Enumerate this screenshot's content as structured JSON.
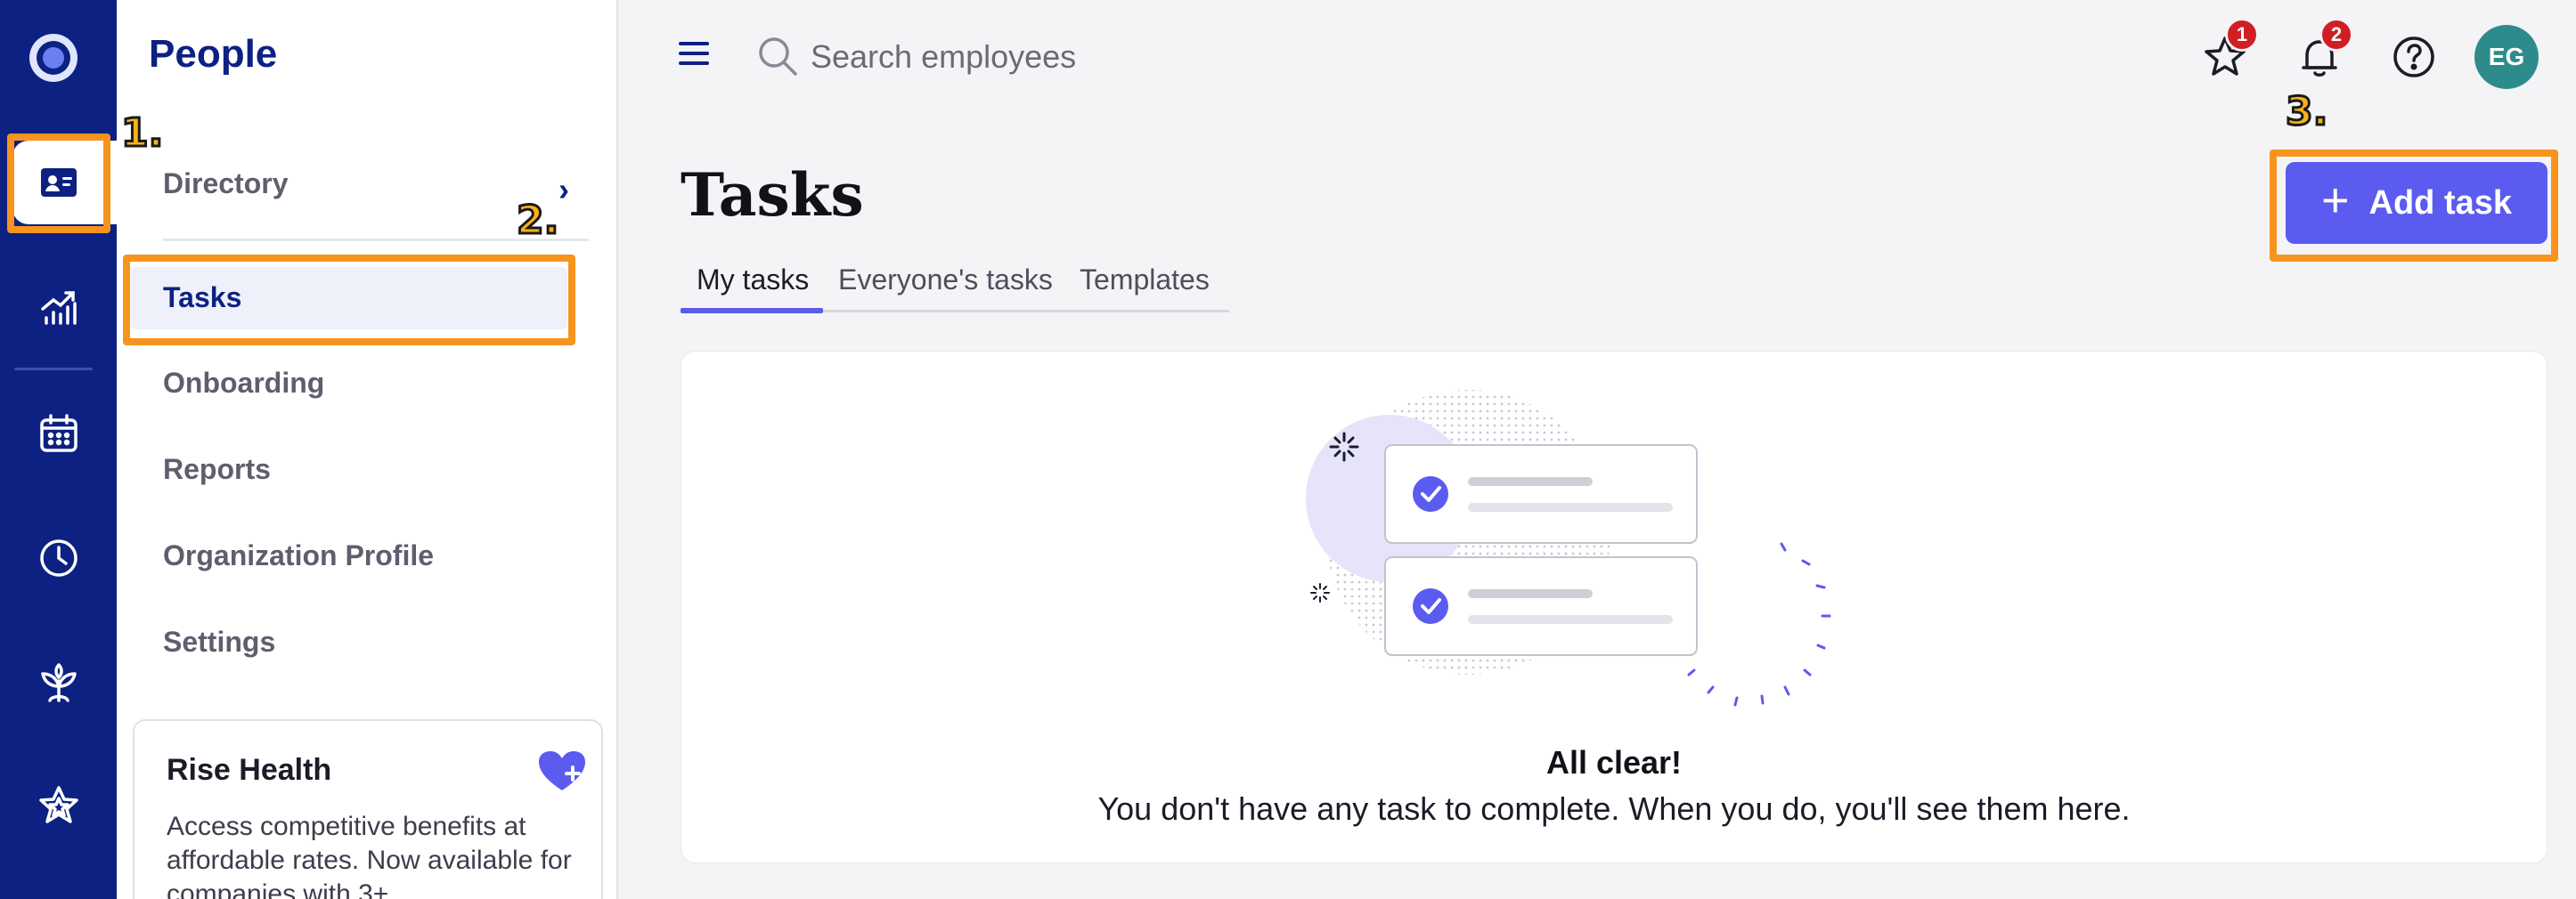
{
  "app": {
    "section_title": "People"
  },
  "rail": {
    "items": [
      {
        "icon": "people-card-icon",
        "active": true
      },
      {
        "icon": "growth-chart-icon",
        "active": false
      },
      {
        "icon": "calendar-icon",
        "active": false
      },
      {
        "icon": "clock-icon",
        "active": false
      },
      {
        "icon": "plant-icon",
        "active": false
      },
      {
        "icon": "star-outline-icon",
        "active": false
      }
    ]
  },
  "subnav": {
    "items": [
      {
        "label": "Directory"
      },
      {
        "label": "Tasks"
      },
      {
        "label": "Onboarding"
      },
      {
        "label": "Reports"
      },
      {
        "label": "Organization Profile"
      },
      {
        "label": "Settings"
      }
    ],
    "active": "Tasks",
    "promo": {
      "title": "Rise Health",
      "text": "Access competitive benefits at affordable rates. Now available for companies with 3+"
    }
  },
  "topbar": {
    "search_placeholder": "Search employees",
    "favorites_badge": "1",
    "notifications_badge": "2",
    "avatar_initials": "EG"
  },
  "page": {
    "title": "Tasks",
    "tabs": [
      "My tasks",
      "Everyone's tasks",
      "Templates"
    ],
    "active_tab": "My tasks",
    "add_button_label": "Add task"
  },
  "empty_state": {
    "title": "All clear!",
    "message": "You don't have any task to complete. When you do, you'll see them here."
  },
  "annotations": {
    "step1": "1.",
    "step2": "2.",
    "step3": "3."
  },
  "colors": {
    "rail": "#0d2182",
    "accent": "#5b5bf0",
    "highlight": "#f7941d",
    "badge": "#d01e22"
  }
}
